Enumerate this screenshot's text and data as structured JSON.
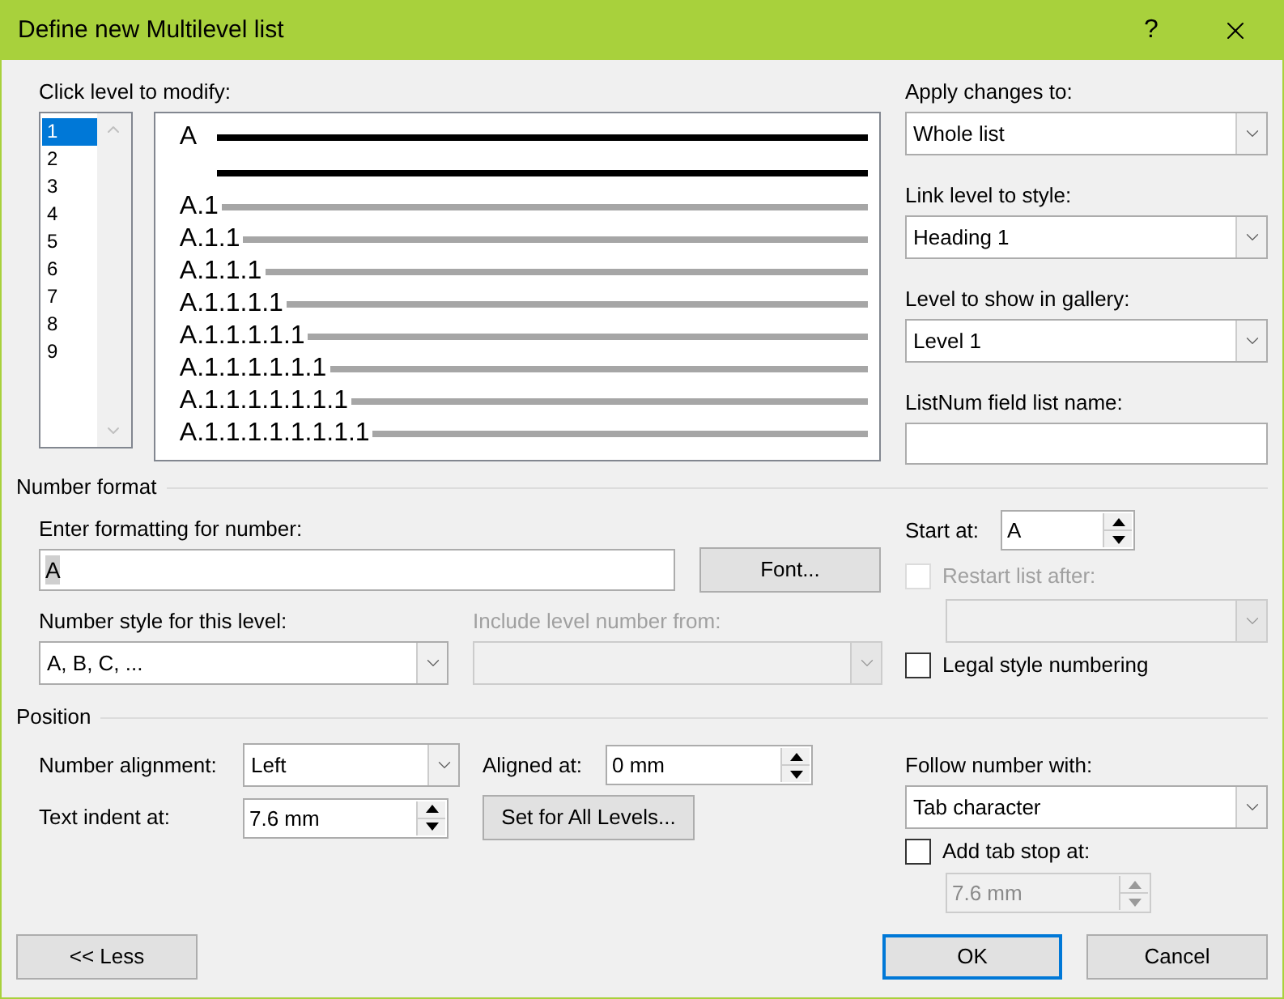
{
  "window": {
    "title": "Define new Multilevel list",
    "help": "?"
  },
  "levels": {
    "label": "Click level to modify:",
    "items": [
      {
        "label": "1",
        "selected": true
      },
      {
        "label": "2",
        "selected": false
      },
      {
        "label": "3",
        "selected": false
      },
      {
        "label": "4",
        "selected": false
      },
      {
        "label": "5",
        "selected": false
      },
      {
        "label": "6",
        "selected": false
      },
      {
        "label": "7",
        "selected": false
      },
      {
        "label": "8",
        "selected": false
      },
      {
        "label": "9",
        "selected": false
      }
    ]
  },
  "preview": {
    "lines": [
      {
        "kind": "heading",
        "number": "A"
      },
      {
        "kind": "heading"
      },
      {
        "kind": "text",
        "number": "A.1"
      },
      {
        "kind": "text",
        "number": "A.1.1"
      },
      {
        "kind": "text",
        "number": "A.1.1.1"
      },
      {
        "kind": "text",
        "number": "A.1.1.1.1"
      },
      {
        "kind": "text",
        "number": "A.1.1.1.1.1"
      },
      {
        "kind": "text",
        "number": "A.1.1.1.1.1.1"
      },
      {
        "kind": "text",
        "number": "A.1.1.1.1.1.1.1"
      },
      {
        "kind": "text",
        "number": "A.1.1.1.1.1.1.1.1"
      }
    ]
  },
  "apply_changes_to": {
    "label": "Apply changes to:",
    "value": "Whole list"
  },
  "link_level_to_style": {
    "label": "Link level to style:",
    "value": "Heading 1"
  },
  "level_to_show_in_gallery": {
    "label": "Level to show in gallery:",
    "value": "Level 1"
  },
  "listnum_field": {
    "label": "ListNum field list name:"
  },
  "number_format": {
    "title": "Number format",
    "formatting": {
      "label": "Enter formatting for number:",
      "value": "A",
      "button": "Font..."
    },
    "number_style": {
      "label": "Number style for this level:",
      "value": "A, B, C, ..."
    },
    "include_level": {
      "label": "Include level number from:",
      "disabled": true
    },
    "start_at": {
      "label": "Start at:",
      "value": "A"
    },
    "restart_list": {
      "label": "Restart list after:",
      "checked": false,
      "disabled": true
    },
    "legal_style": {
      "label": "Legal style numbering",
      "checked": false
    }
  },
  "position": {
    "title": "Position",
    "number_alignment": {
      "label": "Number alignment:",
      "value": "Left"
    },
    "aligned_at": {
      "label": "Aligned at:",
      "value": "0 mm"
    },
    "text_indent": {
      "label": "Text indent at:",
      "value": "7.6 mm"
    },
    "set_all_button": "Set for All Levels...",
    "follow_number": {
      "label": "Follow number with:",
      "value": "Tab character"
    },
    "add_tab_stop": {
      "label": "Add tab stop at:",
      "checked": false
    },
    "tab_stop": {
      "value": "7.6 mm",
      "disabled": true
    }
  },
  "buttons": [
    {
      "label": "<< Less",
      "default": false
    },
    {
      "label": "OK",
      "default": true
    },
    {
      "label": "Cancel",
      "default": false
    }
  ]
}
